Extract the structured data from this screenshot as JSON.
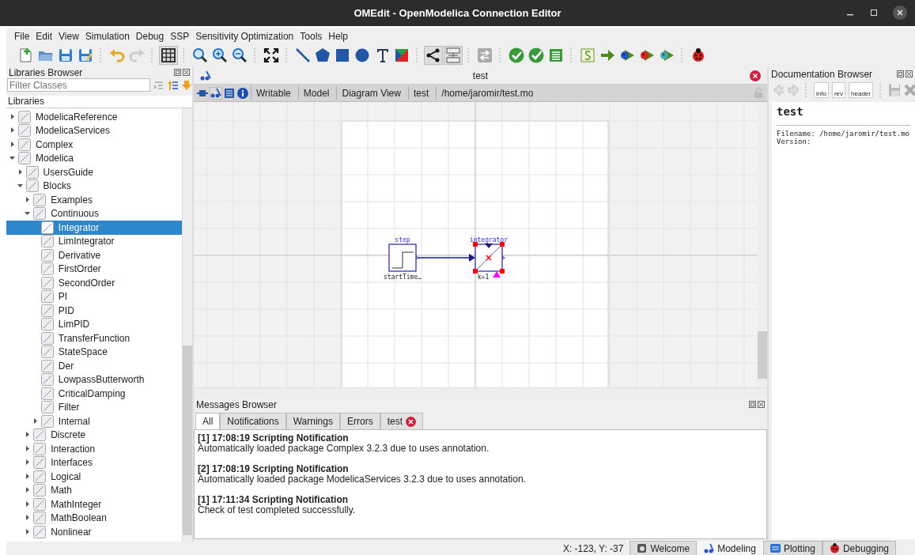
{
  "window": {
    "title": "OMEdit - OpenModelica Connection Editor"
  },
  "menu": [
    "File",
    "Edit",
    "View",
    "Simulation",
    "Debug",
    "SSP",
    "Sensitivity Optimization",
    "Tools",
    "Help"
  ],
  "libraries_browser": {
    "title": "Libraries Browser",
    "filter": {
      "placeholder": "Filter Classes"
    },
    "header": "Libraries",
    "tree": [
      {
        "label": "ModelicaReference",
        "expanded": false,
        "selected": false
      },
      {
        "label": "ModelicaServices",
        "expanded": false,
        "selected": false
      },
      {
        "label": "Complex",
        "expanded": false,
        "selected": false
      },
      {
        "label": "Modelica",
        "expanded": true,
        "selected": false,
        "children": [
          {
            "label": "UsersGuide",
            "expanded": false,
            "selected": false
          },
          {
            "label": "Blocks",
            "expanded": true,
            "selected": false,
            "children": [
              {
                "label": "Examples",
                "expanded": false,
                "selected": false
              },
              {
                "label": "Continuous",
                "expanded": true,
                "selected": false,
                "children": [
                  {
                    "label": "Integrator",
                    "selected": true
                  },
                  {
                    "label": "LimIntegrator",
                    "selected": false
                  },
                  {
                    "label": "Derivative",
                    "selected": false
                  },
                  {
                    "label": "FirstOrder",
                    "selected": false
                  },
                  {
                    "label": "SecondOrder",
                    "selected": false
                  },
                  {
                    "label": "PI",
                    "selected": false
                  },
                  {
                    "label": "PID",
                    "selected": false
                  },
                  {
                    "label": "LimPID",
                    "selected": false
                  },
                  {
                    "label": "TransferFunction",
                    "selected": false
                  },
                  {
                    "label": "StateSpace",
                    "selected": false
                  },
                  {
                    "label": "Der",
                    "selected": false
                  },
                  {
                    "label": "LowpassButterworth",
                    "selected": false
                  },
                  {
                    "label": "CriticalDamping",
                    "selected": false
                  },
                  {
                    "label": "Filter",
                    "selected": false
                  },
                  {
                    "label": "Internal",
                    "expanded": false,
                    "selected": false
                  }
                ]
              },
              {
                "label": "Discrete",
                "expanded": false,
                "selected": false
              },
              {
                "label": "Interaction",
                "expanded": false,
                "selected": false
              },
              {
                "label": "Interfaces",
                "expanded": false,
                "selected": false
              },
              {
                "label": "Logical",
                "expanded": false,
                "selected": false
              },
              {
                "label": "Math",
                "expanded": false,
                "selected": false
              },
              {
                "label": "MathInteger",
                "expanded": false,
                "selected": false
              },
              {
                "label": "MathBoolean",
                "expanded": false,
                "selected": false
              },
              {
                "label": "Nonlinear",
                "expanded": false,
                "selected": false
              }
            ]
          }
        ]
      }
    ]
  },
  "model_tab": {
    "title": "test",
    "toolbar_labels": [
      "Writable",
      "Model",
      "Diagram View",
      "test",
      "/home/jaromir/test.mo"
    ]
  },
  "diagram": {
    "components": [
      {
        "kind": "step",
        "name": "step",
        "parameter": "startTime…",
        "selected": false
      },
      {
        "kind": "integrator",
        "name": "integrator",
        "parameter": "k=1",
        "selected": true
      }
    ]
  },
  "messages_browser": {
    "title": "Messages Browser",
    "tabs": [
      {
        "label": "All",
        "kind": "plain",
        "selected": true
      },
      {
        "label": "Notifications",
        "kind": "plain",
        "selected": false
      },
      {
        "label": "Warnings",
        "kind": "plain",
        "selected": false
      },
      {
        "label": "Errors",
        "kind": "plain",
        "selected": false
      },
      {
        "label": "test",
        "kind": "closable",
        "selected": false
      }
    ],
    "messages": [
      {
        "heading": "[1] 17:08:19 Scripting Notification",
        "text": "Automatically loaded package Complex 3.2.3 due to uses annotation."
      },
      {
        "heading": "[2] 17:08:19 Scripting Notification",
        "text": "Automatically loaded package ModelicaServices 3.2.3 due to uses annotation."
      },
      {
        "heading": "[1] 17:11:34 Scripting Notification",
        "text": "Check of test completed successfully."
      }
    ]
  },
  "documentation_browser": {
    "title": "Documentation Browser",
    "edit_buttons": [
      "info",
      "rev",
      "header"
    ],
    "heading": "test",
    "lines": [
      "Filename: /home/jaromir/test.mo",
      "Version:"
    ]
  },
  "status_bar": {
    "coordinates": "X: -123, Y: -37",
    "perspectives": [
      {
        "label": "Welcome",
        "kind": "welcome",
        "selected": false
      },
      {
        "label": "Modeling",
        "kind": "modeling",
        "selected": true
      },
      {
        "label": "Plotting",
        "kind": "plotting",
        "selected": false
      },
      {
        "label": "Debugging",
        "kind": "debugging",
        "selected": false
      }
    ]
  }
}
